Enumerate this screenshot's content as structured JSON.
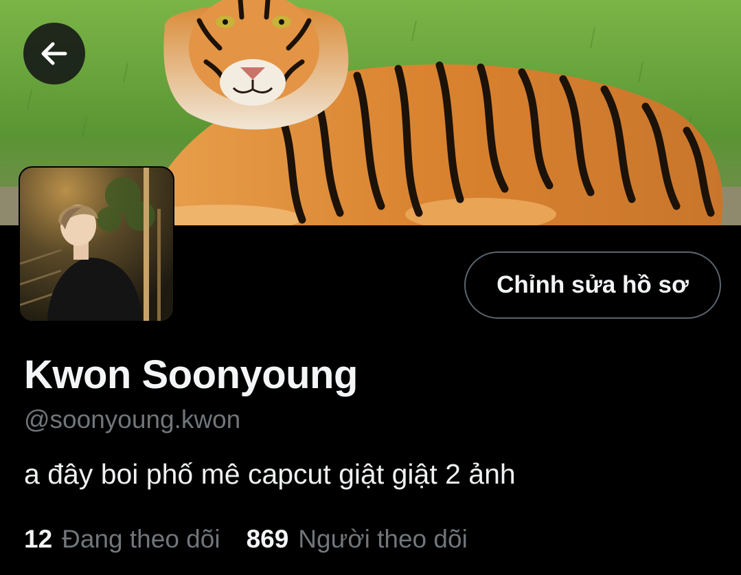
{
  "header": {
    "back_icon": "arrow-left-icon"
  },
  "banner": {
    "image": "tiger-banner"
  },
  "profile": {
    "avatar": "profile-photo",
    "edit_label": "Chỉnh sửa hồ sơ",
    "name": "Kwon Soonyoung",
    "handle": "@soonyoung.kwon",
    "bio": "a đây boi phố mê capcut giật giật 2 ảnh"
  },
  "stats": {
    "following_count": "12",
    "following_label": "Đang theo dõi",
    "followers_count": "869",
    "followers_label": "Người theo dõi"
  },
  "colors": {
    "background": "#000000",
    "primary_text": "#f3f5f6",
    "secondary_text": "#71767b",
    "button_border": "#5b6670"
  }
}
